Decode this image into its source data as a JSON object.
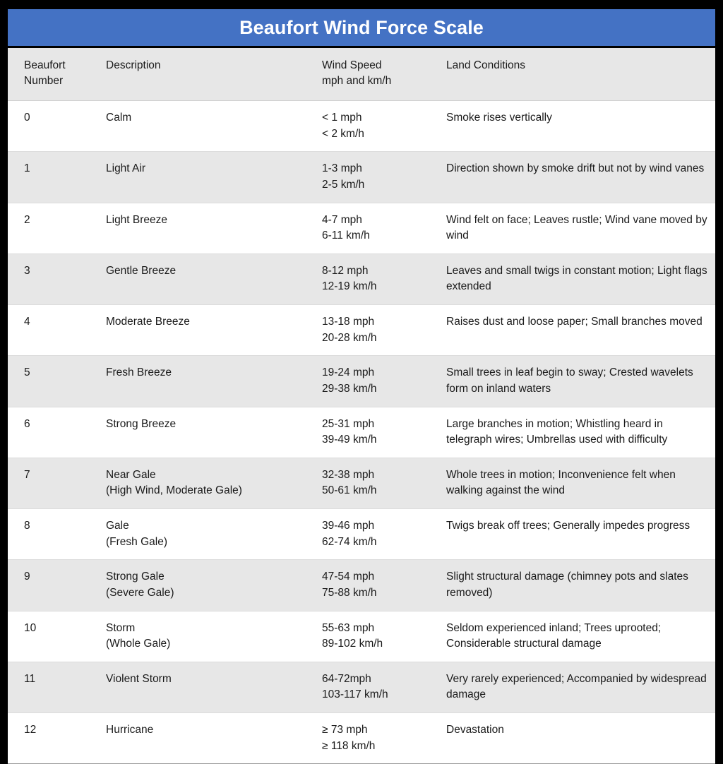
{
  "title": "Beaufort Wind Force Scale",
  "theme": {
    "title_bar_color": "#4472C4",
    "title_text_color": "#FFFFFF",
    "stripe_color": "#E7E7E7",
    "row_color": "#FFFFFF",
    "border_color": "#000000"
  },
  "columns": {
    "number": {
      "line1": "Beaufort",
      "line2": "Number"
    },
    "description": {
      "line1": "Description",
      "line2": ""
    },
    "wind_speed": {
      "line1": "Wind Speed",
      "line2": "mph and km/h"
    },
    "land_conditions": {
      "line1": "Land Conditions",
      "line2": ""
    }
  },
  "rows": [
    {
      "number": "0",
      "description": "Calm",
      "description_alt": "",
      "mph": "< 1 mph",
      "kmh": "< 2 km/h",
      "land": "Smoke rises vertically"
    },
    {
      "number": "1",
      "description": "Light Air",
      "description_alt": "",
      "mph": "1-3 mph",
      "kmh": "2-5 km/h",
      "land": "Direction shown by smoke drift but not by wind vanes"
    },
    {
      "number": "2",
      "description": "Light Breeze",
      "description_alt": "",
      "mph": "4-7 mph",
      "kmh": "6-11 km/h",
      "land": "Wind felt on face; Leaves rustle; Wind vane moved by wind"
    },
    {
      "number": "3",
      "description": "Gentle Breeze",
      "description_alt": "",
      "mph": "8-12 mph",
      "kmh": "12-19 km/h",
      "land": "Leaves and small twigs in constant motion; Light flags extended"
    },
    {
      "number": "4",
      "description": "Moderate Breeze",
      "description_alt": "",
      "mph": "13-18 mph",
      "kmh": "20-28 km/h",
      "land": "Raises dust and loose paper; Small branches moved"
    },
    {
      "number": "5",
      "description": "Fresh Breeze",
      "description_alt": "",
      "mph": "19-24 mph",
      "kmh": "29-38 km/h",
      "land": "Small trees in leaf begin to sway; Crested wavelets form on inland waters"
    },
    {
      "number": "6",
      "description": "Strong Breeze",
      "description_alt": "",
      "mph": "25-31 mph",
      "kmh": "39-49 km/h",
      "land": "Large branches in motion; Whistling heard in telegraph wires; Umbrellas used with difficulty"
    },
    {
      "number": "7",
      "description": "Near Gale",
      "description_alt": "(High Wind, Moderate Gale)",
      "mph": "32-38 mph",
      "kmh": "50-61 km/h",
      "land": "Whole trees in motion; Inconvenience felt when walking against the wind"
    },
    {
      "number": "8",
      "description": "Gale",
      "description_alt": "(Fresh Gale)",
      "mph": "39-46 mph",
      "kmh": "62-74 km/h",
      "land": "Twigs break off trees; Generally impedes progress"
    },
    {
      "number": "9",
      "description": "Strong Gale",
      "description_alt": "(Severe Gale)",
      "mph": "47-54 mph",
      "kmh": "75-88 km/h",
      "land": "Slight structural damage (chimney pots and slates removed)"
    },
    {
      "number": "10",
      "description": "Storm",
      "description_alt": "(Whole Gale)",
      "mph": "55-63 mph",
      "kmh": "89-102 km/h",
      "land": "Seldom experienced inland; Trees uprooted; Considerable structural damage"
    },
    {
      "number": "11",
      "description": "Violent Storm",
      "description_alt": "",
      "mph": "64-72mph",
      "kmh": "103-117 km/h",
      "land": "Very rarely experienced; Accompanied by widespread damage"
    },
    {
      "number": "12",
      "description": "Hurricane",
      "description_alt": "",
      "mph": "≥ 73 mph",
      "kmh": "≥ 118 km/h",
      "land": "Devastation"
    }
  ]
}
